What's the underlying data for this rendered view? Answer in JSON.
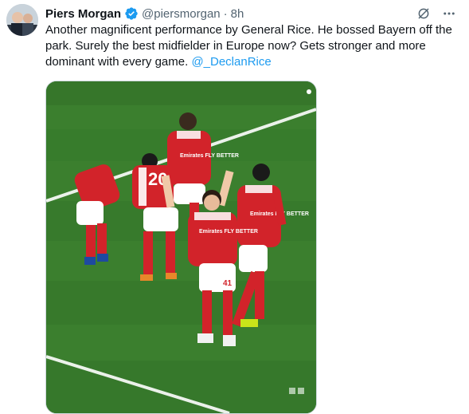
{
  "tweet": {
    "author_name": "Piers Morgan",
    "handle": "@piersmorgan",
    "separator": "·",
    "time": "8h",
    "text": "Another magnificent performance by General Rice. He bossed Bayern off the park. Surely the best midfielder in Europe now? Gets stronger and more dominant with every game.",
    "mention": "@_DeclanRice"
  },
  "icons": {
    "verified": "verified-badge-icon",
    "grok": "grok-icon",
    "more": "more-options-icon"
  },
  "media": {
    "shirt_numbers": [
      "20",
      "41"
    ],
    "shirt_sponsor": "Emirates FLY BETTER"
  },
  "colors": {
    "accent": "#1d9bf0",
    "pitch": "#3a7d2c",
    "kit_red": "#d2232a"
  }
}
